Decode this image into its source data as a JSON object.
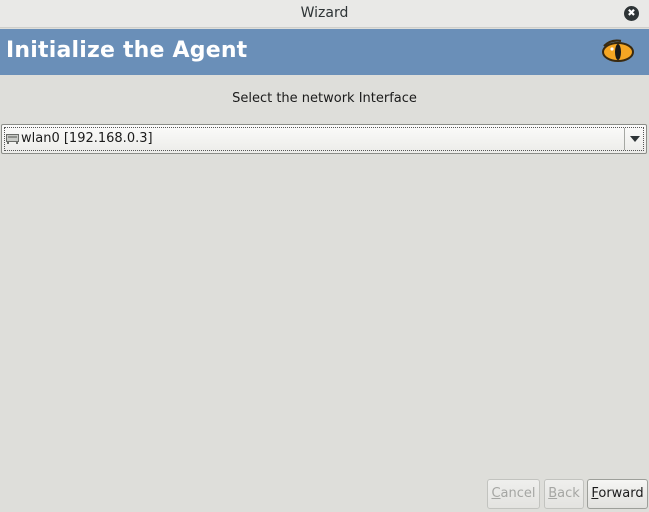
{
  "window": {
    "title": "Wizard",
    "close_glyph": "✖"
  },
  "banner": {
    "title": "Initialize the Agent",
    "logo_icon": "cat-eye-logo"
  },
  "main": {
    "prompt": "Select the network Interface",
    "interface_select": {
      "icon": "network-card-icon",
      "selected_value": "wlan0 [192.168.0.3]"
    }
  },
  "buttons": {
    "cancel": {
      "mnemonic": "C",
      "rest": "ancel",
      "enabled": false
    },
    "back": {
      "mnemonic": "B",
      "rest": "ack",
      "enabled": false
    },
    "forward": {
      "mnemonic": "F",
      "rest": "orward",
      "enabled": true
    }
  },
  "colors": {
    "banner": "#6a8fb8",
    "background": "#dededa",
    "logo_orange": "#f5a623"
  }
}
